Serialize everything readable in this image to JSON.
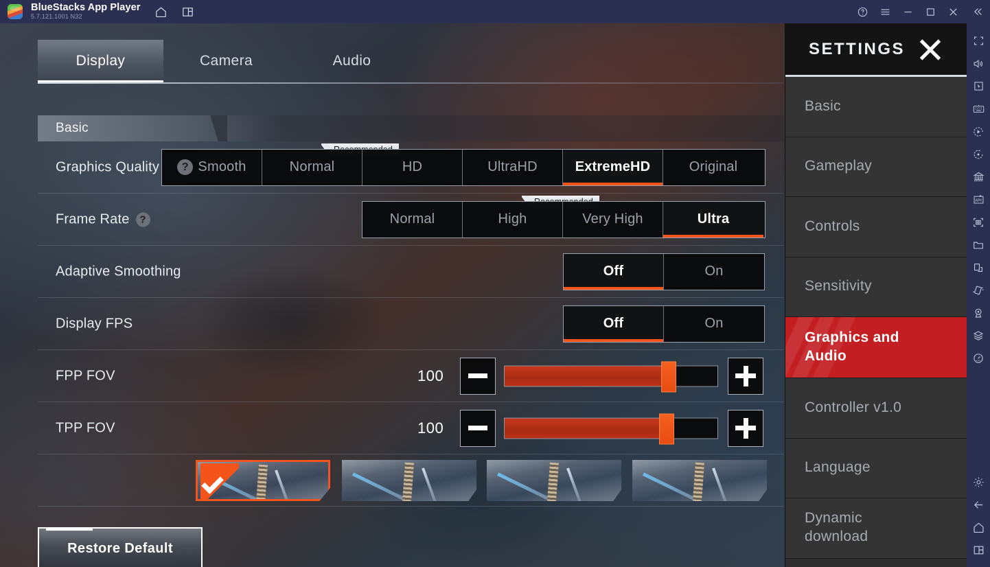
{
  "titlebar": {
    "app_name": "BlueStacks App Player",
    "version": "5.7.121.1001  N32",
    "icons": [
      "bluestacks-logo",
      "home-icon",
      "multi-instance-icon"
    ],
    "window_controls": [
      "help-icon",
      "menu-icon",
      "minimize-icon",
      "maximize-icon",
      "close-icon",
      "collapse-icon"
    ]
  },
  "game_settings": {
    "tabs": [
      {
        "label": "Display",
        "active": true
      },
      {
        "label": "Camera",
        "active": false
      },
      {
        "label": "Audio",
        "active": false
      }
    ],
    "section_title": "Basic",
    "recommended_label": "Recommended",
    "rows": [
      {
        "label": "Graphics Quality",
        "type": "segmented",
        "options": [
          "Smooth",
          "Normal",
          "HD",
          "UltraHD",
          "ExtremeHD",
          "Original"
        ],
        "selected": "ExtremeHD",
        "recommended": "Normal",
        "help_on_option": "Smooth"
      },
      {
        "label": "Frame Rate",
        "type": "segmented",
        "has_help": true,
        "options": [
          "Normal",
          "High",
          "Very High",
          "Ultra"
        ],
        "selected": "Ultra",
        "recommended": "High"
      },
      {
        "label": "Adaptive Smoothing",
        "type": "toggle",
        "options": [
          "Off",
          "On"
        ],
        "selected": "Off"
      },
      {
        "label": "Display FPS",
        "type": "toggle",
        "options": [
          "Off",
          "On"
        ],
        "selected": "Off"
      },
      {
        "label": "FPP FOV",
        "type": "slider",
        "value": "100",
        "percent": 77,
        "minus_label": "minus-icon",
        "plus_label": "plus-icon"
      },
      {
        "label": "TPP FOV",
        "type": "slider",
        "value": "100",
        "percent": 76,
        "minus_label": "minus-icon",
        "plus_label": "plus-icon"
      }
    ],
    "style_thumbnails": [
      {
        "name": "style-1",
        "selected": true
      },
      {
        "name": "style-2",
        "selected": false
      },
      {
        "name": "style-3",
        "selected": false
      },
      {
        "name": "style-4",
        "selected": false
      }
    ],
    "restore_button": "Restore Default"
  },
  "settings_menu": {
    "title": "SETTINGS",
    "close_icon": "close-x-icon",
    "items": [
      {
        "label": "Basic",
        "active": false
      },
      {
        "label": "Gameplay",
        "active": false
      },
      {
        "label": "Controls",
        "active": false
      },
      {
        "label": "Sensitivity",
        "active": false
      },
      {
        "label": "Graphics and Audio",
        "active": true
      },
      {
        "label": "Controller v1.0",
        "active": false
      },
      {
        "label": "Language",
        "active": false
      },
      {
        "label": "Dynamic download",
        "active": false
      }
    ]
  },
  "toolbar": {
    "icons": [
      "fullscreen-icon",
      "volume-icon",
      "cursor-icon",
      "keyboard-icon",
      "macro-record-icon",
      "rotate-icon",
      "multi-instance-icon",
      "install-apk-icon",
      "screenshot-icon",
      "folder-icon",
      "copy-instance-icon",
      "shake-icon",
      "location-icon",
      "layers-icon",
      "gauge-icon"
    ],
    "bottom_icons": [
      "gear-icon",
      "back-icon",
      "home-icon",
      "recents-icon"
    ]
  },
  "colors": {
    "accent_orange": "#f4541a",
    "active_red": "#c31f23",
    "titlebar_blue": "#2b3052",
    "menu_dark": "#2d2d2d"
  }
}
